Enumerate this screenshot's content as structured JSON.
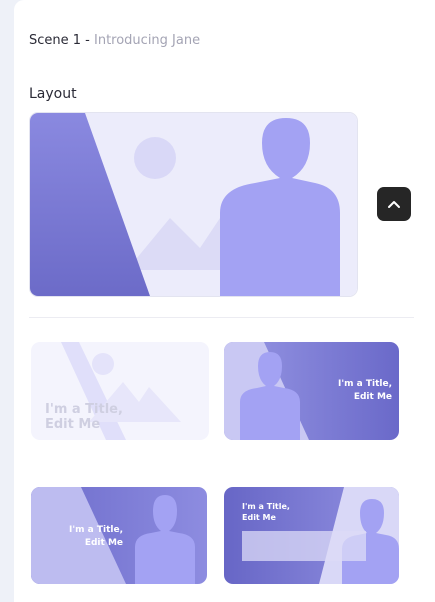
{
  "scene": {
    "prefix": "Scene 1 - ",
    "name": "Introducing Jane"
  },
  "layout_section": {
    "label": "Layout"
  },
  "collapse_button": {
    "icon": "chevron-up-icon"
  },
  "thumbnails": [
    {
      "title_line1": "I'm a Title,",
      "title_line2": "Edit Me"
    },
    {
      "title_line1": "I'm a Title,",
      "title_line2": "Edit Me"
    },
    {
      "title_line1": "I'm a Title,",
      "title_line2": "Edit Me"
    },
    {
      "title_line1": "I'm a Title,",
      "title_line2": "Edit Me"
    }
  ],
  "colors": {
    "accent": "#7f7ed6",
    "figure": "#a3a2f3",
    "background_light": "#ececfb",
    "button_dark": "#262626"
  }
}
